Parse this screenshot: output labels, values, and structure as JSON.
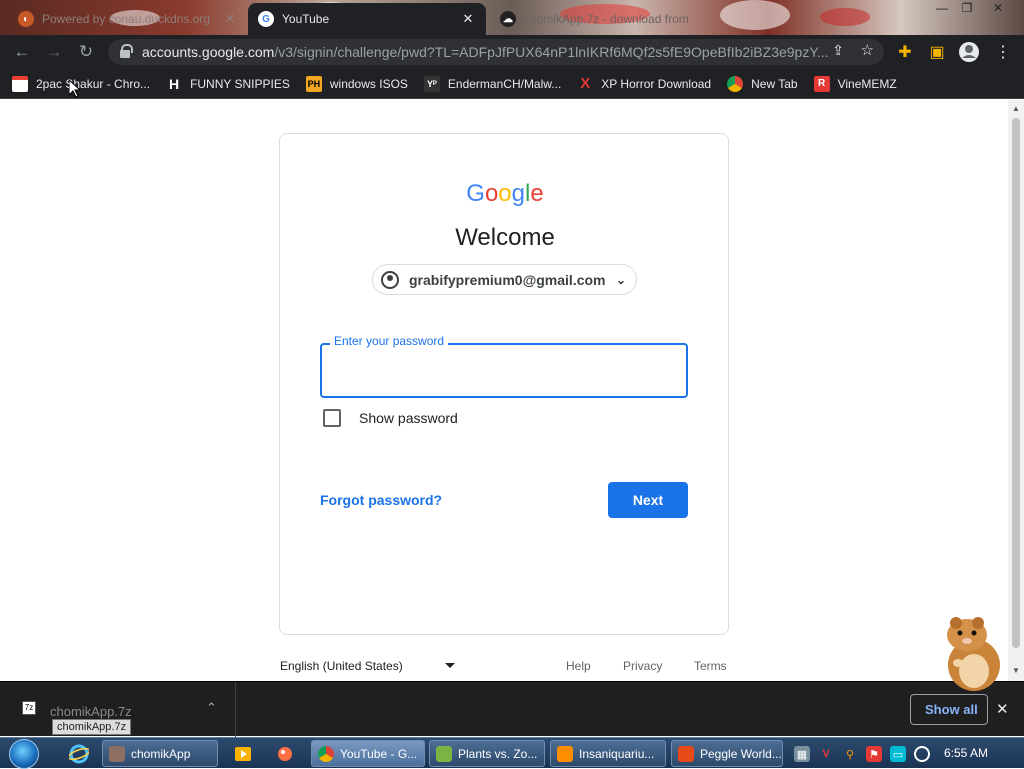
{
  "browser": {
    "tabs": [
      {
        "title": "Powered by conau.duckdns.org",
        "active": false
      },
      {
        "title": "YouTube",
        "active": true
      },
      {
        "title": "chomikApp.7z - download from",
        "active": false
      }
    ],
    "url_host": "accounts.google.com",
    "url_path": "/v3/signin/challenge/pwd?TL=ADFpJfPUX64nP1lnIKRf6MQf2s5fE9OpeBfIb2iBZ3e9pzY...",
    "bookmarks": [
      {
        "label": "2pac Shakur - Chro...",
        "icon": "calendar-icon",
        "color": "#e94235"
      },
      {
        "label": "FUNNY SNIPPIES",
        "icon": "H",
        "color": "#ffffff"
      },
      {
        "label": "windows ISOS",
        "icon": "PH",
        "color": "#f5a623"
      },
      {
        "label": "EndermanCH/Malw...",
        "icon": "Y",
        "color": "#333333"
      },
      {
        "label": "XP Horror Download",
        "icon": "X",
        "color": "#e53935"
      },
      {
        "label": "New Tab",
        "icon": "chrome-icon",
        "color": "#9c27b0"
      },
      {
        "label": "VineMEMZ",
        "icon": "R",
        "color": "#e53935"
      }
    ]
  },
  "signin": {
    "logo_letters": [
      "G",
      "o",
      "o",
      "g",
      "l",
      "e"
    ],
    "logo_colors": [
      "#4285F4",
      "#EA4335",
      "#FBBC05",
      "#4285F4",
      "#34A853",
      "#EA4335"
    ],
    "heading": "Welcome",
    "account_email": "grabifypremium0@gmail.com",
    "password_label": "Enter your password",
    "password_value": "",
    "show_password_label": "Show password",
    "show_password_checked": false,
    "forgot_label": "Forgot password?",
    "next_label": "Next",
    "accent_color": "#1a73e8"
  },
  "footer": {
    "language": "English (United States)",
    "links": [
      "Help",
      "Privacy",
      "Terms"
    ]
  },
  "downloads": {
    "file_name": "chomikApp.7z",
    "tooltip": "chomikApp.7z",
    "show_all_label": "Show all"
  },
  "taskbar": {
    "items": [
      {
        "label": "chomikApp",
        "icon": "app-icon"
      },
      {
        "label": "YouTube - G...",
        "icon": "chrome-icon",
        "active": true
      },
      {
        "label": "Plants vs. Zo...",
        "icon": "plant-icon"
      },
      {
        "label": "Insaniquariu...",
        "icon": "fish-icon"
      },
      {
        "label": "Peggle World...",
        "icon": "peggle-icon"
      }
    ],
    "clock": "6:55 AM"
  }
}
